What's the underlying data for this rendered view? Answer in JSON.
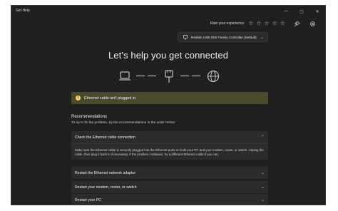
{
  "window": {
    "title": "Get Help"
  },
  "window_controls": {
    "minimize": "—",
    "maximize": "▢",
    "close": "✕"
  },
  "header": {
    "rate_label": "Rate your experience",
    "stars": 5,
    "icons": [
      "pin-icon",
      "settings-icon"
    ]
  },
  "adapter": {
    "value": "Realtek USB GbE Family Controller (Default)"
  },
  "main": {
    "heading": "Let’s help you get connected",
    "alert": "Ethernet cable isn't plugged in.",
    "recommendations_title": "Recommendations",
    "recommendations_sub": "To try to fix the problem, try the recommendations in the order below:"
  },
  "accordions": [
    {
      "title": "Check the Ethernet cable connection",
      "expanded": true,
      "body": "Make sure the Ethernet cable is securely plugged into the Ethernet ports on both your PC and your modem, router, or switch. Unplug the cable, then plug it back in if necessary. If the problem continues, try a different Ethernet cable if you can."
    },
    {
      "title": "Restart the Ethernet network adapter",
      "expanded": false
    },
    {
      "title": "Restart your modem, router, or switch",
      "expanded": false
    },
    {
      "title": "Restart your PC",
      "expanded": false
    }
  ],
  "colors": {
    "background": "#1f1f1f",
    "card": "#2b2b2b",
    "alert_bg": "#4b4a2c",
    "alert_icon": "#f3d37a"
  }
}
